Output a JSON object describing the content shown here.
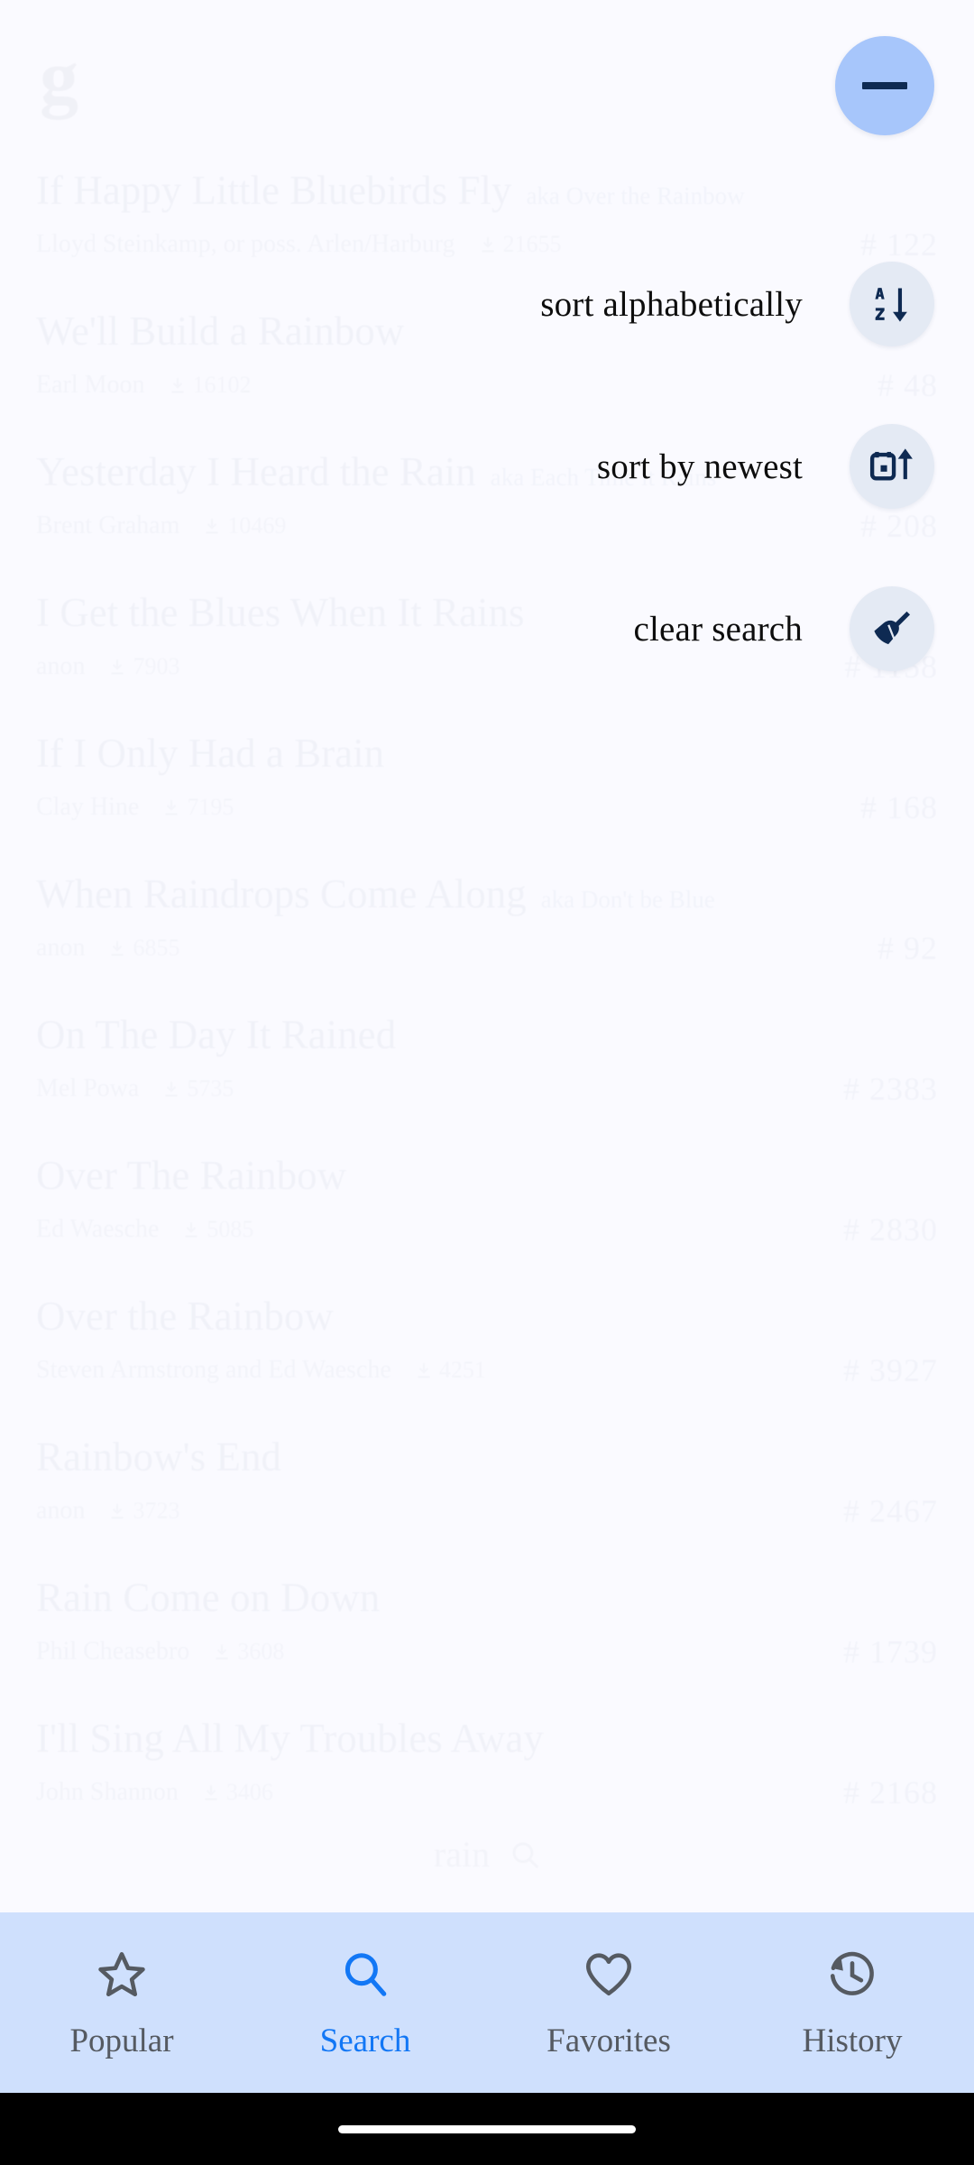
{
  "app": {
    "brand_logo_letter": "g",
    "background_color": "#fafaff"
  },
  "fab": {
    "main_label": "minus-icon",
    "main_color": "#a7c6fb",
    "icon_color": "#0e2a52",
    "actions": [
      {
        "label": "sort alphabetically",
        "icon": "sort-alphabetically-icon"
      },
      {
        "label": "sort by newest",
        "icon": "sort-by-newest-icon"
      },
      {
        "label": "clear search",
        "icon": "clear-search-broom-icon"
      }
    ]
  },
  "search": {
    "query": "rain",
    "icon": "search-icon"
  },
  "results": [
    {
      "title": "If Happy Little Bluebirds Fly",
      "aka": "aka Over the Rainbow",
      "author": "Lloyd Steinkamp, or poss. Arlen/Harburg",
      "downloads": "21655",
      "number": "# 122"
    },
    {
      "title": "We'll Build a Rainbow",
      "aka": "",
      "author": "Earl Moon",
      "downloads": "16102",
      "number": "# 48"
    },
    {
      "title": "Yesterday I Heard the Rain",
      "aka": "aka Each Time it Rains",
      "author": "Brent Graham",
      "downloads": "10469",
      "number": "# 208"
    },
    {
      "title": "I Get the Blues When It Rains",
      "aka": "",
      "author": "anon",
      "downloads": "7903",
      "number": "# 1158"
    },
    {
      "title": "If I Only Had a Brain",
      "aka": "",
      "author": "Clay Hine",
      "downloads": "7195",
      "number": "# 168"
    },
    {
      "title": "When Raindrops Come Along",
      "aka": "aka Don't be Blue",
      "author": "anon",
      "downloads": "6855",
      "number": "# 92"
    },
    {
      "title": "On The Day It Rained",
      "aka": "",
      "author": "Mel Powa",
      "downloads": "5735",
      "number": "# 2383"
    },
    {
      "title": "Over The Rainbow",
      "aka": "",
      "author": "Ed Waesche",
      "downloads": "5085",
      "number": "# 2830"
    },
    {
      "title": "Over the Rainbow",
      "aka": "",
      "author": "Steven Armstrong and Ed Waesche",
      "downloads": "4251",
      "number": "# 3927"
    },
    {
      "title": "Rainbow's End",
      "aka": "",
      "author": "anon",
      "downloads": "3723",
      "number": "# 2467"
    },
    {
      "title": "Rain Come on Down",
      "aka": "",
      "author": "Phil Cheasebro",
      "downloads": "3608",
      "number": "# 1739"
    },
    {
      "title": "I'll Sing All My Troubles Away",
      "aka": "",
      "author": "John Shannon",
      "downloads": "3406",
      "number": "# 2168"
    }
  ],
  "bottom_nav": {
    "active_color": "#1277f5",
    "inactive_color": "#555a61",
    "background": "#cfe0fd",
    "items": [
      {
        "label": "Popular",
        "icon": "star-icon",
        "active": false
      },
      {
        "label": "Search",
        "icon": "search-icon",
        "active": true
      },
      {
        "label": "Favorites",
        "icon": "heart-icon",
        "active": false
      },
      {
        "label": "History",
        "icon": "history-clock-icon",
        "active": false
      }
    ]
  }
}
